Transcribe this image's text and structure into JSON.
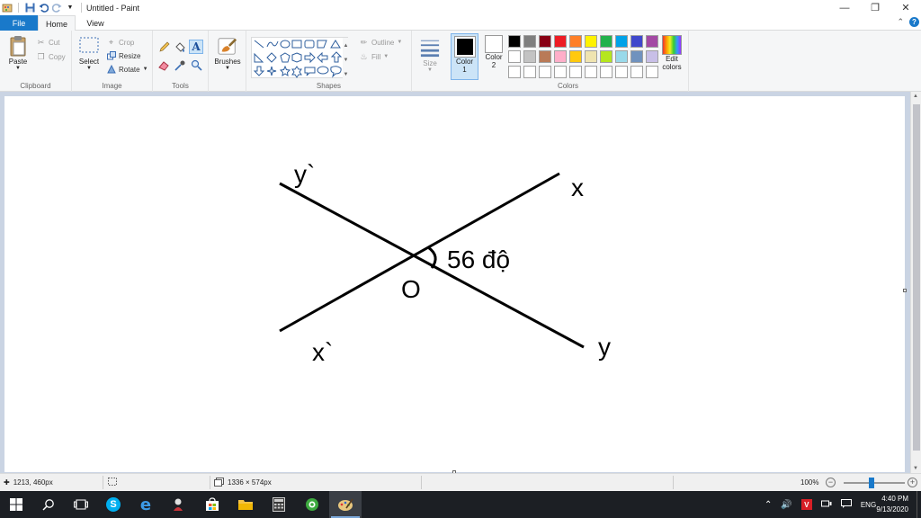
{
  "window": {
    "title": "Untitled - Paint",
    "minimize": "—",
    "restore": "❐",
    "close": "✕"
  },
  "tabs": {
    "file": "File",
    "home": "Home",
    "view": "View"
  },
  "ribbon": {
    "clipboard": {
      "label": "Clipboard",
      "paste": "Paste",
      "cut": "Cut",
      "copy": "Copy"
    },
    "image": {
      "label": "Image",
      "select": "Select",
      "crop": "Crop",
      "resize": "Resize",
      "rotate": "Rotate"
    },
    "tools": {
      "label": "Tools"
    },
    "brushes": {
      "label": "Brushes"
    },
    "shapes": {
      "label": "Shapes",
      "outline": "Outline",
      "fill": "Fill"
    },
    "size": {
      "label": "Size"
    },
    "colors": {
      "label": "Colors",
      "color1": "Color\n1",
      "color1_line1": "Color",
      "color1_line2": "1",
      "color2_line1": "Color",
      "color2_line2": "2",
      "color1_value": "#000000",
      "color2_value": "#ffffff",
      "edit_line1": "Edit",
      "edit_line2": "colors",
      "palette": [
        "#000000",
        "#7f7f7f",
        "#880015",
        "#ed1c24",
        "#ff7f27",
        "#fff200",
        "#22b14c",
        "#00a2e8",
        "#3f48cc",
        "#a349a4",
        "#ffffff",
        "#c3c3c3",
        "#b97a57",
        "#ffaec9",
        "#ffc90e",
        "#efe4b0",
        "#b5e61d",
        "#99d9ea",
        "#7092be",
        "#c8bfe7",
        "#ffffff",
        "#ffffff",
        "#ffffff",
        "#ffffff",
        "#ffffff",
        "#ffffff",
        "#ffffff",
        "#ffffff",
        "#ffffff",
        "#ffffff"
      ]
    }
  },
  "drawing": {
    "label_y_prime": "y`",
    "label_x": "x",
    "label_angle": "56 độ",
    "label_o": "O",
    "label_x_prime": "x`",
    "label_y": "y"
  },
  "statusbar": {
    "cursor_pos": "1213, 460px",
    "image_size": "1336 × 574px",
    "zoom": "100%"
  },
  "taskbar": {
    "language": "ENG",
    "time": "4:40 PM",
    "date": "9/13/2020"
  }
}
